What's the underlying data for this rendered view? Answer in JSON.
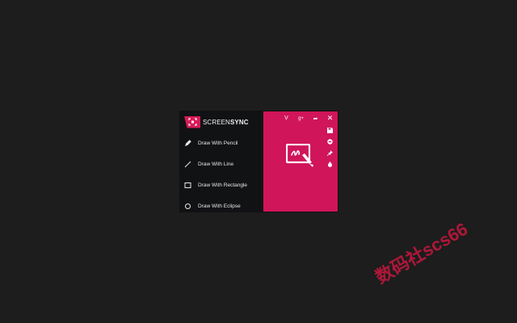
{
  "brand": {
    "name_light": "SCREEN",
    "name_bold": "SYNC"
  },
  "menu": {
    "items": [
      {
        "label": "Draw With Pencil",
        "icon": "pencil-icon"
      },
      {
        "label": "Draw With Line",
        "icon": "line-icon"
      },
      {
        "label": "Draw With Rectangle",
        "icon": "rectangle-icon"
      },
      {
        "label": "Draw With Eclipse",
        "icon": "ellipse-icon"
      }
    ]
  },
  "toolbar": {
    "top": [
      {
        "name": "chevron-down-icon",
        "glyph": "V"
      },
      {
        "name": "google-plus-icon",
        "glyph": "g+"
      },
      {
        "name": "share-icon",
        "glyph": "➦"
      },
      {
        "name": "close-icon",
        "glyph": "✕"
      }
    ],
    "side": [
      "save-icon",
      "print-icon",
      "pin-icon",
      "color-drop-icon"
    ]
  },
  "colors": {
    "accent": "#d0155a",
    "panel": "#111214",
    "background": "#1d1d1d"
  },
  "watermark": {
    "text": "数码社scs66"
  }
}
